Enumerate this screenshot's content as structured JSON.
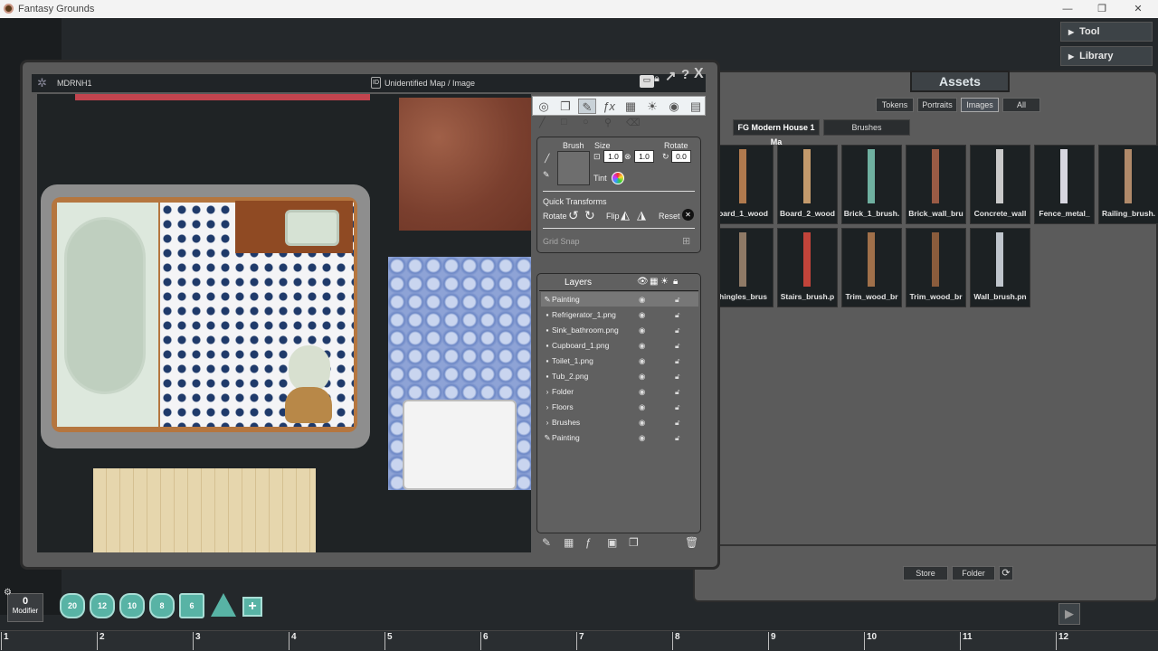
{
  "window": {
    "title": "Fantasy Grounds",
    "min": "—",
    "max": "❐",
    "close": "✕"
  },
  "top_buttons": {
    "tool": "Tool",
    "library": "Library"
  },
  "assets": {
    "title": "Assets",
    "filters": [
      "Tokens",
      "Portraits",
      "Images",
      "All"
    ],
    "active_filter": "Images",
    "breadcrumb": [
      "FG Modern House 1 Ma",
      "Brushes"
    ],
    "tiles": [
      {
        "name": "oard_1_wood",
        "color": "#b07a4e"
      },
      {
        "name": "Board_2_wood",
        "color": "#c39a6c"
      },
      {
        "name": "Brick_1_brush.",
        "color": "#6fb0a0"
      },
      {
        "name": "Brick_wall_bru",
        "color": "#9a5b45"
      },
      {
        "name": "Concrete_wall",
        "color": "#c9c9c9"
      },
      {
        "name": "Fence_metal_",
        "color": "#d7d7e0"
      },
      {
        "name": "Railing_brush.",
        "color": "#b08a6a"
      },
      {
        "name": "hingles_brus",
        "color": "#8f7a66"
      },
      {
        "name": "Stairs_brush.p",
        "color": "#c2443a"
      },
      {
        "name": "Trim_wood_br",
        "color": "#a0704a"
      },
      {
        "name": "Trim_wood_br",
        "color": "#8a5c3c"
      },
      {
        "name": "Wall_brush.pn",
        "color": "#bfc5cc"
      }
    ],
    "store": "Store",
    "folder": "Folder"
  },
  "map": {
    "name": "MDRNH1",
    "id_label": "ID",
    "subtitle": "Unidentified Map / Image"
  },
  "tools": {
    "brush": "Brush",
    "size": "Size",
    "rotate": "Rotate",
    "size_w": "1.0",
    "size_h": "1.0",
    "rotate_val": "0.0",
    "tint": "Tint",
    "quick_transforms": "Quick Transforms",
    "rotate_lbl": "Rotate",
    "flip_lbl": "Flip",
    "reset_lbl": "Reset",
    "grid_snap": "Grid Snap"
  },
  "layers": {
    "title": "Layers",
    "rows": [
      {
        "icon": "✎",
        "name": "Painting"
      },
      {
        "icon": "▪",
        "name": "Refrigerator_1.png"
      },
      {
        "icon": "▪",
        "name": "Sink_bathroom.png"
      },
      {
        "icon": "▪",
        "name": "Cupboard_1.png"
      },
      {
        "icon": "▪",
        "name": "Toilet_1.png"
      },
      {
        "icon": "▪",
        "name": "Tub_2.png"
      },
      {
        "icon": "›",
        "name": "Folder"
      },
      {
        "icon": "›",
        "name": "Floors"
      },
      {
        "icon": "›",
        "name": "Brushes"
      },
      {
        "icon": "✎",
        "name": "Painting"
      }
    ]
  },
  "modifier": {
    "value": "0",
    "label": "Modifier"
  },
  "dice": [
    "20",
    "12",
    "10",
    "8",
    "6"
  ],
  "ruler": [
    "1",
    "2",
    "3",
    "4",
    "5",
    "6",
    "7",
    "8",
    "9",
    "10",
    "11",
    "12"
  ]
}
